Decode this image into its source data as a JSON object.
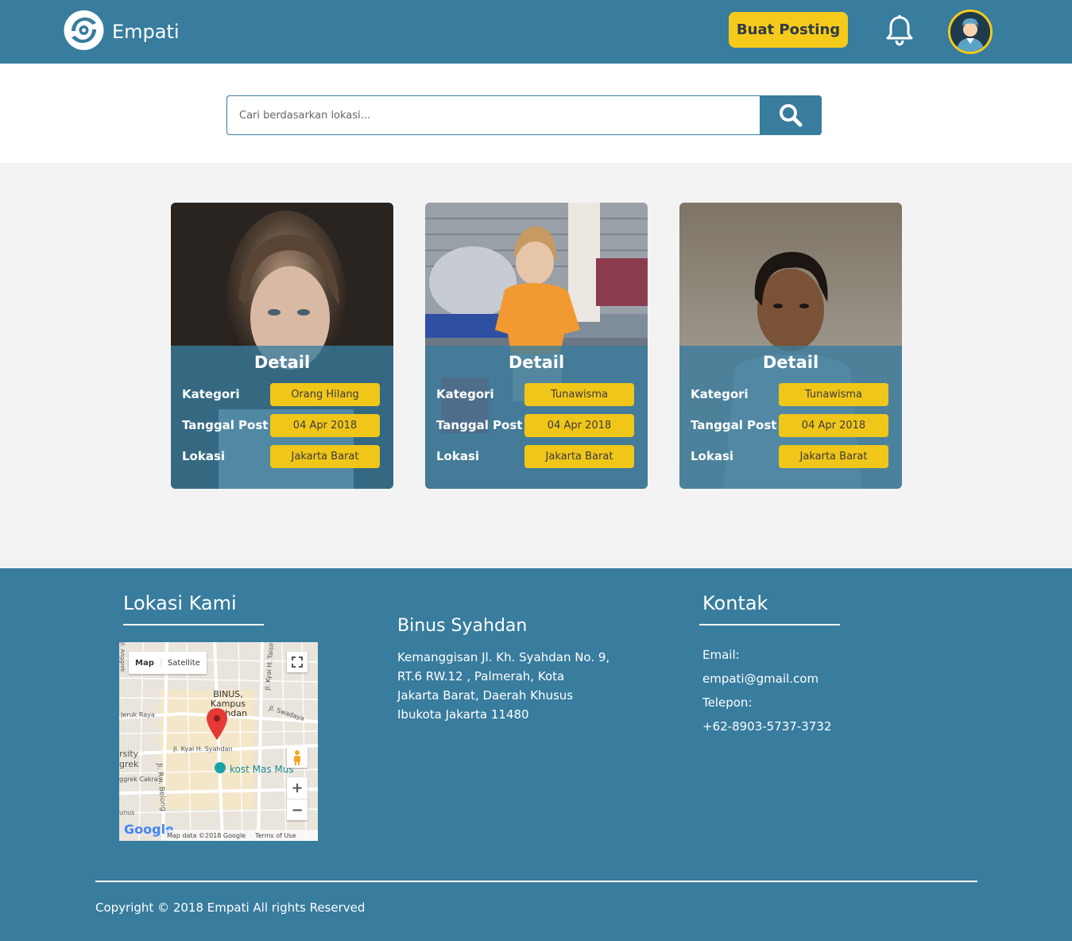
{
  "header": {
    "brand": "Empati",
    "post_button": "Buat Posting",
    "bell_icon": "bell-icon",
    "avatar_icon": "user-avatar"
  },
  "search": {
    "placeholder": "Cari berdasarkan lokasi...",
    "button_icon": "search-icon"
  },
  "cards": [
    {
      "title": "Detail",
      "kategori_label": "Kategori",
      "kategori": "Orang Hilang",
      "tanggal_label": "Tanggal Post",
      "tanggal": "04 Apr 2018",
      "lokasi_label": "Lokasi",
      "lokasi": "Jakarta Barat"
    },
    {
      "title": "Detail",
      "kategori_label": "Kategori",
      "kategori": "Tunawisma",
      "tanggal_label": "Tanggal Post",
      "tanggal": "04 Apr 2018",
      "lokasi_label": "Lokasi",
      "lokasi": "Jakarta Barat"
    },
    {
      "title": "Detail",
      "kategori_label": "Kategori",
      "kategori": "Tunawisma",
      "tanggal_label": "Tanggal Post",
      "tanggal": "04 Apr 2018",
      "lokasi_label": "Lokasi",
      "lokasi": "Jakarta Barat"
    }
  ],
  "footer": {
    "location_title": "Lokasi Kami",
    "map": {
      "map_tab": "Map",
      "satellite_tab": "Satellite",
      "place_label": "BINUS, Kampus Syahdan",
      "street_1": "Jl. Kyai H. Syahdan",
      "street_2": "Jl. Rw. Belong",
      "street_3": "Jl. Kyai H. Taisir",
      "street_4": "Jeruk Raya",
      "street_5": "Jl. Swadaya",
      "poi": "kost Mas Mus",
      "edge_1": "rsity",
      "edge_2": "grek",
      "edge_3": "ggrek Cakra",
      "edge_4": "unus",
      "edge_5": "Jl. Anggrek",
      "google": "Google",
      "map_data": "Map data ©2018 Google",
      "terms": "Terms of Use",
      "zoom_in": "+",
      "zoom_out": "−"
    },
    "address_title": "Binus Syahdan",
    "address_lines": [
      "Kemanggisan Jl. Kh. Syahdan No. 9,",
      "RT.6 RW.12 , Palmerah, Kota",
      "Jakarta Barat, Daerah Khusus",
      "Ibukota Jakarta 11480"
    ],
    "contact_title": "Kontak",
    "email_label": "Email:",
    "email": "empati@gmail.com",
    "phone_label": "Telepon:",
    "phone": "+62-8903-5737-3732",
    "copyright": "Copyright © 2018 Empati All rights Reserved"
  }
}
